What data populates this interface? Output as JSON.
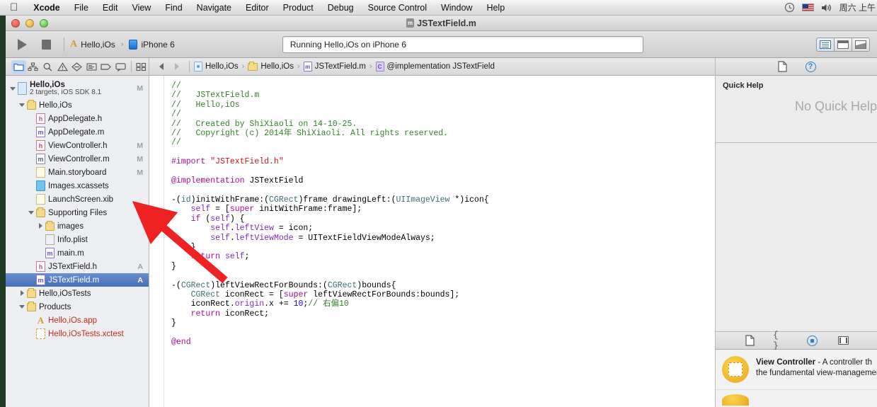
{
  "menubar": {
    "apple_icon": "apple-icon",
    "items": [
      {
        "label": "Xcode",
        "bold": true
      },
      {
        "label": "File",
        "bold": false
      },
      {
        "label": "Edit",
        "bold": false
      },
      {
        "label": "View",
        "bold": false
      },
      {
        "label": "Find",
        "bold": false
      },
      {
        "label": "Navigate",
        "bold": false
      },
      {
        "label": "Editor",
        "bold": false
      },
      {
        "label": "Product",
        "bold": false
      },
      {
        "label": "Debug",
        "bold": false
      },
      {
        "label": "Source Control",
        "bold": false
      },
      {
        "label": "Window",
        "bold": false
      },
      {
        "label": "Help",
        "bold": false
      }
    ],
    "status": {
      "clock_icon": "time-machine-icon",
      "flag_icon": "input-flag-icon",
      "volume_icon": "volume-icon",
      "datetime": "周六 上午"
    }
  },
  "window": {
    "title": "JSTextField.m",
    "title_icon": "m-file-icon"
  },
  "toolbar": {
    "run_button": "run-icon",
    "stop_button": "stop-icon",
    "scheme_name": "Hello,iOs",
    "scheme_separator": "›",
    "destination": "iPhone 6",
    "status_text": "Running Hello,iOs on iPhone 6",
    "editor_buttons": [
      {
        "name": "standard-editor",
        "active": true
      },
      {
        "name": "assistant-editor",
        "active": false
      },
      {
        "name": "version-editor",
        "active": false
      }
    ]
  },
  "navigator": {
    "tabs": [
      {
        "name": "project-navigator",
        "icon": "folder-icon",
        "active": true
      },
      {
        "name": "symbol-navigator",
        "icon": "hierarchy-icon",
        "active": false
      },
      {
        "name": "find-navigator",
        "icon": "search-icon",
        "active": false
      },
      {
        "name": "issue-navigator",
        "icon": "warning-icon",
        "active": false
      },
      {
        "name": "test-navigator",
        "icon": "diamond-icon",
        "active": false
      },
      {
        "name": "debug-navigator",
        "icon": "list-icon",
        "active": false
      },
      {
        "name": "breakpoint-navigator",
        "icon": "tag-icon",
        "active": false
      },
      {
        "name": "log-navigator",
        "icon": "speech-icon",
        "active": false
      },
      {
        "name": "report-navigator",
        "icon": "grid-icon",
        "active": false
      }
    ],
    "tree": [
      {
        "id": "project",
        "label": "Hello,iOs",
        "sub": "2 targets, iOS SDK 8.1",
        "icon": "project",
        "indent": 0,
        "twisty": "down",
        "badge": "M",
        "selected": false,
        "type": "project"
      },
      {
        "id": "group-hello",
        "label": "Hello,iOs",
        "icon": "folder",
        "indent": 1,
        "twisty": "down",
        "badge": "",
        "selected": false
      },
      {
        "id": "appdelegate-h",
        "label": "AppDelegate.h",
        "icon": "h",
        "indent": 2,
        "twisty": "",
        "badge": "",
        "selected": false
      },
      {
        "id": "appdelegate-m",
        "label": "AppDelegate.m",
        "icon": "m",
        "indent": 2,
        "twisty": "",
        "badge": "",
        "selected": false
      },
      {
        "id": "viewcontroller-h",
        "label": "ViewController.h",
        "icon": "h",
        "indent": 2,
        "twisty": "",
        "badge": "M",
        "selected": false
      },
      {
        "id": "viewcontroller-m",
        "label": "ViewController.m",
        "icon": "mg",
        "indent": 2,
        "twisty": "",
        "badge": "M",
        "selected": false
      },
      {
        "id": "main-storyboard",
        "label": "Main.storyboard",
        "icon": "sb",
        "indent": 2,
        "twisty": "",
        "badge": "M",
        "selected": false
      },
      {
        "id": "images-xcassets",
        "label": "Images.xcassets",
        "icon": "xc",
        "indent": 2,
        "twisty": "",
        "badge": "",
        "selected": false
      },
      {
        "id": "launchscreen-xib",
        "label": "LaunchScreen.xib",
        "icon": "xib",
        "indent": 2,
        "twisty": "",
        "badge": "",
        "selected": false
      },
      {
        "id": "supporting-files",
        "label": "Supporting Files",
        "icon": "folder",
        "indent": 2,
        "twisty": "down",
        "badge": "",
        "selected": false
      },
      {
        "id": "images-folder",
        "label": "images",
        "icon": "folder",
        "indent": 3,
        "twisty": "right",
        "badge": "",
        "selected": false
      },
      {
        "id": "info-plist",
        "label": "Info.plist",
        "icon": "plist",
        "indent": 3,
        "twisty": "",
        "badge": "",
        "selected": false
      },
      {
        "id": "main-m",
        "label": "main.m",
        "icon": "m",
        "indent": 3,
        "twisty": "",
        "badge": "",
        "selected": false
      },
      {
        "id": "jstextfield-h",
        "label": "JSTextField.h",
        "icon": "h",
        "indent": 2,
        "twisty": "",
        "badge": "A",
        "selected": false
      },
      {
        "id": "jstextfield-m",
        "label": "JSTextField.m",
        "icon": "m",
        "indent": 2,
        "twisty": "",
        "badge": "A",
        "selected": true
      },
      {
        "id": "hello-iostests",
        "label": "Hello,iOsTests",
        "icon": "folder",
        "indent": 1,
        "twisty": "right",
        "badge": "",
        "selected": false
      },
      {
        "id": "products",
        "label": "Products",
        "icon": "folder",
        "indent": 1,
        "twisty": "down",
        "badge": "",
        "selected": false
      },
      {
        "id": "hello-ios-app",
        "label": "Hello,iOs.app",
        "icon": "app",
        "indent": 2,
        "twisty": "",
        "badge": "",
        "selected": false,
        "red": true
      },
      {
        "id": "hello-iostests-xctest",
        "label": "Hello,iOsTests.xctest",
        "icon": "test",
        "indent": 2,
        "twisty": "",
        "badge": "",
        "selected": false,
        "red": true
      }
    ]
  },
  "jumpbar": {
    "back_icon": "back-arrow-icon",
    "forward_icon": "forward-arrow-icon",
    "crumbs": [
      {
        "label": "Hello,iOs",
        "icon": "file"
      },
      {
        "label": "Hello,iOs",
        "icon": "folder"
      },
      {
        "label": "JSTextField.m",
        "icon": "m"
      },
      {
        "label": "@implementation JSTextField",
        "icon": "c"
      }
    ],
    "separator": "›"
  },
  "editor": {
    "code_lines": [
      [
        {
          "t": "//",
          "c": "cmt"
        }
      ],
      [
        {
          "t": "//   JSTextField.m",
          "c": "cmt"
        }
      ],
      [
        {
          "t": "//   Hello,iOs",
          "c": "cmt"
        }
      ],
      [
        {
          "t": "//",
          "c": "cmt"
        }
      ],
      [
        {
          "t": "//   Created by ShiXiaoli on 14-10-25.",
          "c": "cmt"
        }
      ],
      [
        {
          "t": "//   Copyright (c) 2014年 ShiXiaoli. All rights reserved.",
          "c": "cmt"
        }
      ],
      [
        {
          "t": "//",
          "c": "cmt"
        }
      ],
      [],
      [
        {
          "t": "#import ",
          "c": "kw"
        },
        {
          "t": "\"JSTextField.h\"",
          "c": "str"
        }
      ],
      [],
      [
        {
          "t": "@implementation",
          "c": "kw"
        },
        {
          "t": " JSTextField",
          "c": ""
        }
      ],
      [],
      [
        {
          "t": "-(",
          "c": ""
        },
        {
          "t": "id",
          "c": "typ"
        },
        {
          "t": ")initWithFrame:(",
          "c": ""
        },
        {
          "t": "CGRect",
          "c": "typ"
        },
        {
          "t": ")frame drawingLeft:(",
          "c": ""
        },
        {
          "t": "UIImageView",
          "c": "typ"
        },
        {
          "t": " *)icon{",
          "c": ""
        }
      ],
      [
        {
          "t": "    ",
          "c": ""
        },
        {
          "t": "self",
          "c": "prop"
        },
        {
          "t": " = [",
          "c": ""
        },
        {
          "t": "super",
          "c": "kw"
        },
        {
          "t": " initWithFrame:frame];",
          "c": ""
        }
      ],
      [
        {
          "t": "    ",
          "c": ""
        },
        {
          "t": "if",
          "c": "kw"
        },
        {
          "t": " (",
          "c": ""
        },
        {
          "t": "self",
          "c": "prop"
        },
        {
          "t": ") {",
          "c": ""
        }
      ],
      [
        {
          "t": "        ",
          "c": ""
        },
        {
          "t": "self",
          "c": "prop"
        },
        {
          "t": ".",
          "c": ""
        },
        {
          "t": "leftView",
          "c": "prop"
        },
        {
          "t": " = icon;",
          "c": ""
        }
      ],
      [
        {
          "t": "        ",
          "c": ""
        },
        {
          "t": "self",
          "c": "prop"
        },
        {
          "t": ".",
          "c": ""
        },
        {
          "t": "leftViewMode",
          "c": "prop"
        },
        {
          "t": " = UITextFieldViewModeAlways;",
          "c": ""
        }
      ],
      [
        {
          "t": "    }",
          "c": ""
        }
      ],
      [
        {
          "t": "    ",
          "c": ""
        },
        {
          "t": "return",
          "c": "kw"
        },
        {
          "t": " ",
          "c": ""
        },
        {
          "t": "self",
          "c": "prop"
        },
        {
          "t": ";",
          "c": ""
        }
      ],
      [
        {
          "t": "}",
          "c": ""
        }
      ],
      [],
      [
        {
          "t": "-(",
          "c": ""
        },
        {
          "t": "CGRect",
          "c": "typ"
        },
        {
          "t": ")leftViewRectForBounds:(",
          "c": ""
        },
        {
          "t": "CGRect",
          "c": "typ"
        },
        {
          "t": ")bounds{",
          "c": ""
        }
      ],
      [
        {
          "t": "    ",
          "c": ""
        },
        {
          "t": "CGRect",
          "c": "typ"
        },
        {
          "t": " iconRect = [",
          "c": ""
        },
        {
          "t": "super",
          "c": "kw"
        },
        {
          "t": " leftViewRectForBounds:bounds];",
          "c": ""
        }
      ],
      [
        {
          "t": "    iconRect.",
          "c": ""
        },
        {
          "t": "origin",
          "c": "prop"
        },
        {
          "t": ".x += ",
          "c": ""
        },
        {
          "t": "10",
          "c": "num"
        },
        {
          "t": ";",
          "c": ""
        },
        {
          "t": "// 右偏10",
          "c": "cmt"
        }
      ],
      [
        {
          "t": "    ",
          "c": ""
        },
        {
          "t": "return",
          "c": "kw"
        },
        {
          "t": " iconRect;",
          "c": ""
        }
      ],
      [
        {
          "t": "}",
          "c": ""
        }
      ],
      [],
      [
        {
          "t": "@end",
          "c": "kw"
        }
      ]
    ]
  },
  "utilities": {
    "inspector_tabs": [
      {
        "name": "file-inspector",
        "icon": "document-icon",
        "active": false
      },
      {
        "name": "quick-help-inspector",
        "icon": "help-icon",
        "active": true
      }
    ],
    "quick_help": {
      "title": "Quick Help",
      "empty_text": "No Quick Help"
    },
    "library_tabs": [
      {
        "name": "file-template-library",
        "icon": "document-icon",
        "active": false
      },
      {
        "name": "code-snippet-library",
        "icon": "braces-icon",
        "active": false
      },
      {
        "name": "object-library",
        "icon": "object-icon",
        "active": true
      },
      {
        "name": "media-library",
        "icon": "media-icon",
        "active": false
      }
    ],
    "library_items": [
      {
        "name": "View Controller",
        "description": " - A controller th",
        "description2": "the fundamental view-managemen",
        "icon": "view-controller-icon"
      }
    ]
  },
  "annotation": {
    "arrow_color": "#ee2222",
    "arrow_name": "red-pointer-arrow"
  }
}
